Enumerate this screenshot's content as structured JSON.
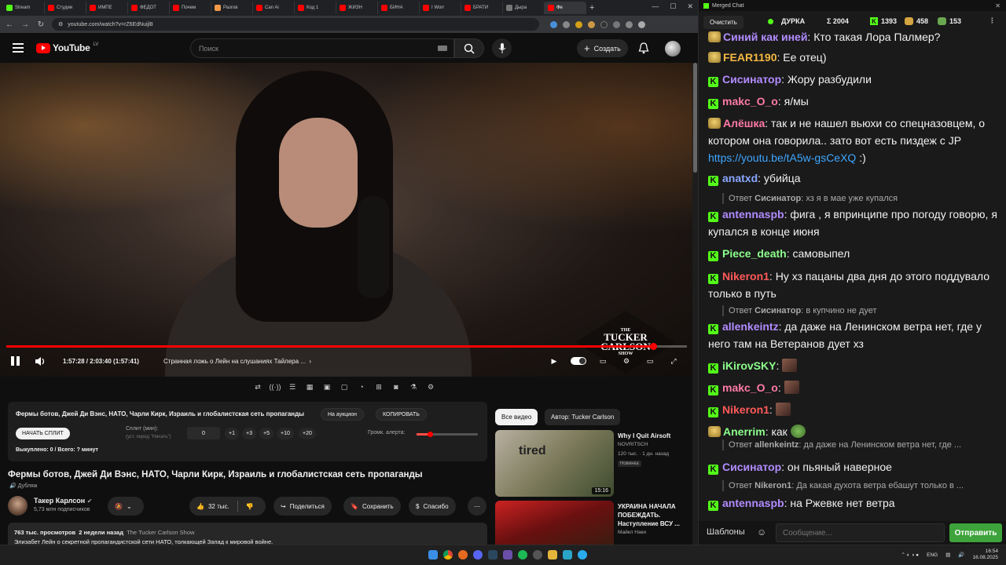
{
  "browser": {
    "tabs": [
      {
        "label": "Stream",
        "color": "#53fc18"
      },
      {
        "label": "Студии",
        "color": "#ff0000"
      },
      {
        "label": "ИМПЕ",
        "color": "#ff0000"
      },
      {
        "label": "ФЕДОТ",
        "color": "#ff0000"
      },
      {
        "label": "Почем",
        "color": "#ff0000"
      },
      {
        "label": "Разгов",
        "color": "#f2994a"
      },
      {
        "label": "Can Ai",
        "color": "#ff0000"
      },
      {
        "label": "Код 1",
        "color": "#ff0000"
      },
      {
        "label": "ЖИЗН",
        "color": "#ff0000"
      },
      {
        "label": "БИНА",
        "color": "#ff0000"
      },
      {
        "label": "I Worr",
        "color": "#ff0000"
      },
      {
        "label": "БРАТИ",
        "color": "#ff0000"
      },
      {
        "label": "Дыра",
        "color": "#777777"
      },
      {
        "label": "Фе",
        "color": "#ff0000"
      }
    ],
    "url": "youtube.com/watch?v=rZ6EdNuijl8"
  },
  "youtube": {
    "logo_text": "YouTube",
    "region": "LV",
    "search_placeholder": "Поиск",
    "create_label": "Создать",
    "time": "1:57:28 / 2:03:40 (1:57:41)",
    "chapter": "Странная ложь о Лейн на слушаниях Тайлера ...",
    "progress": 0.95,
    "show_logo": {
      "l1": "THE",
      "l2": "TUCKER",
      "l3": "CARLSON",
      "l4": "SHOW"
    },
    "panel": {
      "title": "Фермы ботов, Джей Ди Вэнс, НАТО, Чарли Кирк, Израиль и глобалистская сеть пропаганды",
      "auction": "На аукцион",
      "copy": "КОПИРОВАТЬ",
      "start_split": "НАЧАТЬ СПЛИТ",
      "split_label": "Сплит (мин):",
      "split_sub": "(уст. перед \"Начать\")",
      "split_value": "0",
      "increments": [
        "+1",
        "+3",
        "+5",
        "+10",
        "+20"
      ],
      "alert_label": "Громк. алерта:",
      "alert_level": 0.22,
      "bought": "Выкуплено: 0 / Всего: ? минут"
    },
    "video_title": "Фермы ботов, Джей Ди Вэнс, НАТО, Чарли Кирк, Израиль и глобалистская сеть пропаганды",
    "dub": "Дубляж",
    "channel": {
      "name": "Такер Карлсон",
      "subs": "5,73 млн подписчиков"
    },
    "actions": {
      "likes": "32 тыс.",
      "share": "Поделиться",
      "save": "Сохранить",
      "thanks": "Спасибо"
    },
    "desc": {
      "views": "763 тыс. просмотров",
      "ago": "2 недели назад",
      "show": "The Tucker Carlson Show",
      "text": "Элизабет Лейн о секретной пропагандистской сети НАТО, толкающей Запад к мировой войне."
    },
    "chips": {
      "all": "Все видео",
      "author": "Автор: Tucker Carlson"
    },
    "recs": [
      {
        "title": "Why I Quit Airsoft",
        "channel": "NOVRITSCH",
        "meta": "120 тыс. · 1 дн. назад",
        "badge": "Новинка",
        "duration": "15:16",
        "thumb_word": "tired"
      },
      {
        "title": "УКРАИНА НАЧАЛА ПОБЕЖДАТЬ. Наступление ВСУ ...",
        "channel": "Майкл Наки",
        "meta": "",
        "badge": "",
        "duration": "",
        "thumb_word": ""
      }
    ]
  },
  "chat": {
    "window_title": "Merged Chat",
    "clear": "Очистить",
    "stats": {
      "name": "ДУРКА",
      "sum": "Σ 2004",
      "kick": "1393",
      "gold": "458",
      "green": "153"
    },
    "messages": [
      {
        "type": "msg",
        "name": "Синий как иней",
        "color": "#b28cff",
        "text": ": Кто такая Лора Палмер?",
        "badge": "em"
      },
      {
        "type": "msg",
        "name": "FEAR1190",
        "color": "#f5b942",
        "text": ": Ее отец)",
        "badge": "em"
      },
      {
        "type": "msg",
        "name": "Сисинатор",
        "color": "#b28cff",
        "text": ": Жору разбудили",
        "badge": "kick"
      },
      {
        "type": "msg",
        "name": "makc_O_o",
        "color": "#ff7aa8",
        "text": ": я/мы",
        "badge": "kick"
      },
      {
        "type": "msg",
        "name": "Алёшка",
        "color": "#ff7aa8",
        "text": ": так и не нашел вьюхи со спецназовцем, о котором она говорила.. зато вот есть пиздеж с JP ",
        "badge": "em",
        "link": "https://youtu.be/tA5w-gsCeXQ",
        "after": " :)"
      },
      {
        "type": "msg",
        "name": "anatxd",
        "color": "#8aa7ff",
        "text": ": убийца",
        "badge": "kick"
      },
      {
        "type": "reply",
        "pre": "Ответ ",
        "name": "Сисинатор",
        "text": ": хз я в мае уже купался"
      },
      {
        "type": "msg",
        "name": "antennaspb",
        "color": "#b28cff",
        "text": ": фига , я впринципе про погоду говорю, я купался в конце июня",
        "badge": "kick"
      },
      {
        "type": "msg",
        "name": "Piece_death",
        "color": "#8cff8c",
        "text": ": самовыпел",
        "badge": "kick"
      },
      {
        "type": "msg",
        "name": "Nikeron1",
        "color": "#ff5a5a",
        "text": ": Ну хз пацаны два дня до этого поддувало только в путь",
        "badge": "kick"
      },
      {
        "type": "reply",
        "pre": "Ответ ",
        "name": "Сисинатор",
        "text": ": в купчино не дует"
      },
      {
        "type": "msg",
        "name": "allenkeintz",
        "color": "#b28cff",
        "text": ": да даже на Ленинском ветра  нет, где у него там на Ветеранов дует хз",
        "badge": "kick"
      },
      {
        "type": "msg",
        "name": "iKirovSKY",
        "color": "#8cff8c",
        "text": ": ",
        "badge": "kick",
        "emote": true
      },
      {
        "type": "msg",
        "name": "makc_O_o",
        "color": "#ff7aa8",
        "text": ": ",
        "badge": "kick",
        "emote": true
      },
      {
        "type": "msg",
        "name": "Nikeron1",
        "color": "#ff5a5a",
        "text": ": ",
        "badge": "kick",
        "emote": true
      },
      {
        "type": "msg",
        "name": "Anerrim",
        "color": "#8cff8c",
        "text": ": как ",
        "badge": "em",
        "emote": true
      },
      {
        "type": "reply",
        "pre": "Ответ ",
        "name": "allenkeintz",
        "text": ": да даже на Ленинском ветра нет, где ..."
      },
      {
        "type": "msg",
        "name": "Сисинатор",
        "color": "#b28cff",
        "text": ": он пьяный наверное",
        "badge": "kick"
      },
      {
        "type": "reply",
        "pre": "Ответ ",
        "name": "Nikeron1",
        "text": ": Да какая духота ветра ебашут только в ..."
      },
      {
        "type": "msg",
        "name": "antennaspb",
        "color": "#b28cff",
        "text": ": на Ржевке нет ветра",
        "badge": "kick"
      }
    ],
    "templates": "Шаблоны",
    "input_placeholder": "Сообщение...",
    "send": "Отправить"
  },
  "taskbar": {
    "lang": "ENG",
    "time": "16:54",
    "date": "16.08.2025"
  },
  "icons": [
    "search-icon",
    "mic-icon",
    "bell-icon",
    "plus-icon",
    "pause-icon",
    "volume-icon",
    "settings-icon",
    "fullscreen-icon",
    "like-icon",
    "dislike-icon",
    "share-icon",
    "save-icon",
    "thanks-icon",
    "more-icon",
    "kick-icon",
    "smile-icon"
  ]
}
